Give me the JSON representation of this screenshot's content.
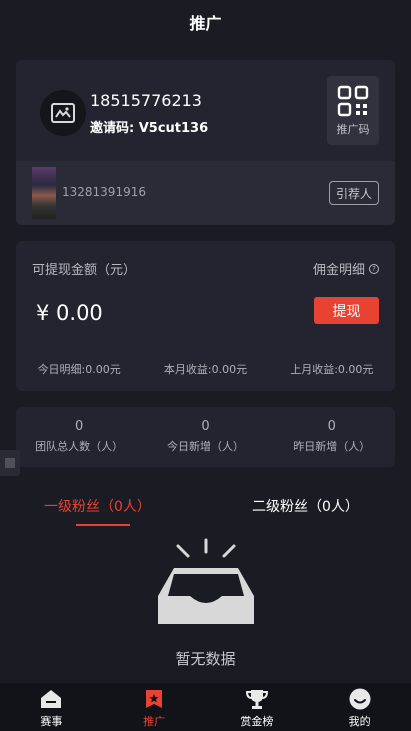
{
  "header": {
    "title": "推广"
  },
  "profile": {
    "phone": "18515776213",
    "invite_code": "邀请码: V5cut136",
    "qr_label": "推广码"
  },
  "referrer": {
    "phone": "13281391916",
    "button_label": "引荐人"
  },
  "earnings": {
    "withdrawable_label": "可提现金额（元）",
    "commission_label": "佣金明细",
    "amount": "¥ 0.00",
    "withdraw_button": "提现",
    "stats": [
      {
        "text": "今日明细:0.00元"
      },
      {
        "text": "本月收益:0.00元"
      },
      {
        "text": "上月收益:0.00元"
      }
    ]
  },
  "team": [
    {
      "value": "0",
      "label": "团队总人数（人）"
    },
    {
      "value": "0",
      "label": "今日新增（人）"
    },
    {
      "value": "0",
      "label": "昨日新增（人）"
    }
  ],
  "fans_tabs": {
    "level1": "一级粉丝（0人）",
    "level2": "二级粉丝（0人）",
    "active": "level1"
  },
  "empty": {
    "text": "暂无数据"
  },
  "tabbar": {
    "items": [
      {
        "label": "赛事",
        "icon": "home-icon"
      },
      {
        "label": "推广",
        "icon": "promote-icon"
      },
      {
        "label": "赏金榜",
        "icon": "trophy-icon"
      },
      {
        "label": "我的",
        "icon": "smile-icon"
      }
    ],
    "active_index": 1
  },
  "colors": {
    "accent": "#e84232",
    "background": "#1b1b24",
    "card": "#242431"
  }
}
